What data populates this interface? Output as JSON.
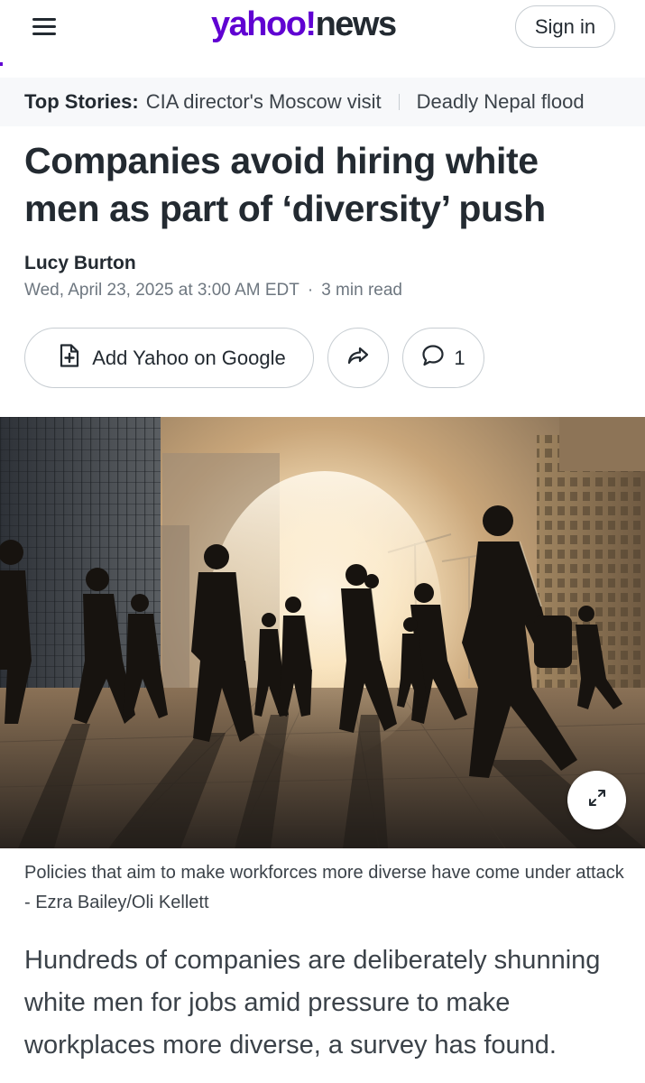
{
  "header": {
    "logo_primary": "yahoo!",
    "logo_secondary": "news",
    "sign_in_label": "Sign in",
    "brand_color": "#6001d2",
    "icons": {
      "menu": "hamburger-menu-icon"
    }
  },
  "top_stories": {
    "label": "Top Stories:",
    "items": [
      "CIA director's Moscow visit",
      "Deadly Nepal flood"
    ]
  },
  "article": {
    "headline": "Companies avoid hiring white men as part of ‘diversity’ push",
    "author": "Lucy Burton",
    "date": "Wed, April 23, 2025 at 3:00 AM EDT",
    "separator": "·",
    "read_time": "3 min read",
    "actions": {
      "add_google_label": "Add Yahoo on Google",
      "comment_count": "1",
      "icons": {
        "add_google": "add-document-icon",
        "share": "share-arrow-icon",
        "comments": "speech-bubble-icon",
        "expand": "expand-diagonal-icon"
      }
    },
    "image_caption": "Policies that aim to make workforces more diverse have come under attack - Ezra Bailey/Oli Kellett",
    "body_paragraph": "Hundreds of companies are deliberately shunning white men for jobs amid pressure to make workplaces more diverse, a survey has found."
  }
}
